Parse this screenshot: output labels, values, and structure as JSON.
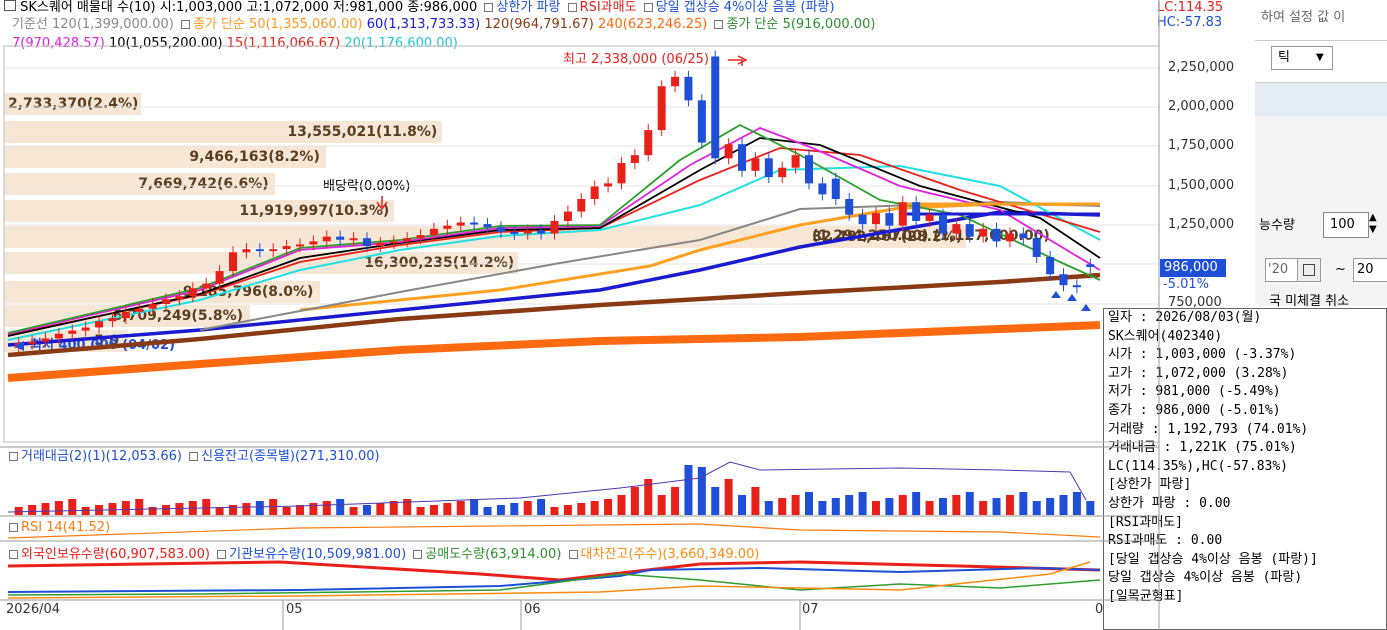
{
  "legend": {
    "line1_prefix": "SK스퀘어 매물대 수(10)",
    "line1_ohlc": "시:1,003,000 고:1,072,000 저:981,000 종:986,000",
    "line1_upper": "상한가 파랑",
    "line1_rsi": "RSI과매도",
    "line1_gap": "당일 갭상승 4%이상 음봉 (파랑)",
    "lc": "LC:114.35",
    "hc": "HC:-57.83",
    "line2_base": "기준선 120(1,399,000.00)",
    "line2_simple50": "종가 단순 50(1,355,060.00)",
    "line2_60": "60(1,313,733.33)",
    "line2_120": "120(964,791.67)",
    "line2_240": "240(623,246.25)",
    "line2_simple5": "종가 단순 5(916,000.00)",
    "line3_7": "7(970,428.57)",
    "line3_10": "10(1,055,200.00)",
    "line3_15": "15(1,116,066.67)",
    "line3_20": "20(1,176,600.00)"
  },
  "price_axis": {
    "ticks": [
      "2,250,000",
      "2,000,000",
      "1,750,000",
      "1,500,000",
      "1,250,000",
      "1,000,000",
      "750,000"
    ],
    "current_price": "986,000",
    "current_change": "-5.01%"
  },
  "annotations": {
    "high": "최고 2,338,000 (06/25)",
    "dividend": "배당락(0.00%)",
    "low": "최저 400,000 (04/02)"
  },
  "volume_profile": [
    {
      "label": "2,733,370(2.4%)"
    },
    {
      "label": "13,555,021(11.8%)"
    },
    {
      "label": "9,466,163(8.2%)"
    },
    {
      "label": "7,669,742(6.6%)"
    },
    {
      "label": "11,919,997(10.3%)"
    },
    {
      "label": "16,300,235(14.2%)"
    },
    {
      "label": "32,482,467(28.2%)"
    },
    {
      "label": "9,185,796(8.0%)"
    },
    {
      "label": "6,709,249(5.8%)"
    },
    {
      "label": "5,0"
    }
  ],
  "mid_overlay_text": "(1,294,250.00)  (1,127,000.00)",
  "sub_panels": {
    "volume_title": "거래대금(2)(1)(12,053.66)",
    "credit_title": "신용잔고(종목별)(271,310.00)",
    "rsi_title": "RSI 14(41.52)",
    "foreign": "외국인보유수량(60,907,583.00)",
    "institution": "기관보유수량(10,509,981.00)",
    "short": "공매도수량(63,914.00)",
    "lending": "대차잔고(주수)(3,660,349.00)"
  },
  "x_axis": [
    "2026/04",
    "05",
    "06",
    "07",
    "0"
  ],
  "right_panel": {
    "settings_text": "하여 설정 값 이",
    "tick_label": "틱",
    "qty_label": "능수량",
    "qty_value": "100",
    "date_from": "'20",
    "date_to": "20",
    "tilde": "~",
    "unfilled": "국 미체결 취소"
  },
  "tooltip": {
    "date": "일자     : 2026/08/03(월)",
    "name": "SK스퀘어(402340)",
    "open": " 시가     : 1,003,000 (-3.37%)",
    "high": " 고가     : 1,072,000 (3.28%)",
    "low": " 저가     : 981,000 (-5.49%)",
    "close": " 종가     : 986,000 (-5.01%)",
    "volume": " 거래량   : 1,192,793 (74.01%)",
    "amount": " 거래대금 : 1,221K (75.01%)",
    "lchc": " LC(114.35%),HC(-57.83%)",
    "s1_title": "[상한가 파랑]",
    "s1_val": " 상한가 파랑 : 0.00",
    "s2_title": "[RSI과매도]",
    "s2_val": " RSI과매도 : 0.00",
    "s3_title": "[당일 갭상승 4%이상 음봉 (파랑)]",
    "s3_val": " 당일 갭상승 4%이상 음봉 (파랑)",
    "s4_title": "[일목균형표]"
  },
  "colors": {
    "up": "#e8201a",
    "down": "#1e4fd6",
    "ma5": "#2e9e2e",
    "ma7": "#e020e0",
    "ma10": "#000000",
    "ma15": "#e8201a",
    "ma20": "#20e0e0",
    "ma60": "#1a1ad0",
    "ma50": "#ffa020",
    "ma120": "#8a3a12",
    "ma240": "#ff6a10",
    "base": "#888888"
  },
  "candles": [
    {
      "o": 470000,
      "c": 500000
    },
    {
      "o": 500000,
      "c": 510000
    },
    {
      "o": 510000,
      "c": 530000
    },
    {
      "o": 530000,
      "c": 560000
    },
    {
      "o": 560000,
      "c": 580000
    },
    {
      "o": 580000,
      "c": 600000
    },
    {
      "o": 600000,
      "c": 640000
    },
    {
      "o": 640000,
      "c": 660000
    },
    {
      "o": 660000,
      "c": 700000
    },
    {
      "o": 700000,
      "c": 720000
    },
    {
      "o": 720000,
      "c": 750000
    },
    {
      "o": 750000,
      "c": 780000
    },
    {
      "o": 780000,
      "c": 800000
    },
    {
      "o": 800000,
      "c": 850000
    },
    {
      "o": 850000,
      "c": 880000
    },
    {
      "o": 880000,
      "c": 960000
    },
    {
      "o": 960000,
      "c": 1080000
    },
    {
      "o": 1080000,
      "c": 1100000
    },
    {
      "o": 1100000,
      "c": 1090000
    },
    {
      "o": 1090000,
      "c": 1100000
    },
    {
      "o": 1100000,
      "c": 1120000
    },
    {
      "o": 1120000,
      "c": 1130000
    },
    {
      "o": 1130000,
      "c": 1150000
    },
    {
      "o": 1150000,
      "c": 1180000
    },
    {
      "o": 1180000,
      "c": 1160000
    },
    {
      "o": 1160000,
      "c": 1170000
    },
    {
      "o": 1170000,
      "c": 1120000
    },
    {
      "o": 1120000,
      "c": 1140000
    },
    {
      "o": 1140000,
      "c": 1150000
    },
    {
      "o": 1150000,
      "c": 1170000
    },
    {
      "o": 1170000,
      "c": 1190000
    },
    {
      "o": 1190000,
      "c": 1230000
    },
    {
      "o": 1230000,
      "c": 1250000
    },
    {
      "o": 1250000,
      "c": 1270000
    },
    {
      "o": 1270000,
      "c": 1260000
    },
    {
      "o": 1260000,
      "c": 1240000
    },
    {
      "o": 1240000,
      "c": 1210000
    },
    {
      "o": 1210000,
      "c": 1200000
    },
    {
      "o": 1200000,
      "c": 1220000
    },
    {
      "o": 1220000,
      "c": 1200000
    },
    {
      "o": 1200000,
      "c": 1280000
    },
    {
      "o": 1280000,
      "c": 1340000
    },
    {
      "o": 1340000,
      "c": 1420000
    },
    {
      "o": 1420000,
      "c": 1500000
    },
    {
      "o": 1500000,
      "c": 1520000
    },
    {
      "o": 1520000,
      "c": 1650000
    },
    {
      "o": 1650000,
      "c": 1700000
    },
    {
      "o": 1700000,
      "c": 1860000
    },
    {
      "o": 1860000,
      "c": 2140000
    },
    {
      "o": 2140000,
      "c": 2200000
    },
    {
      "o": 2200000,
      "c": 2050000
    },
    {
      "o": 2050000,
      "c": 1780000
    },
    {
      "o": 2330000,
      "c": 1680000
    },
    {
      "o": 1680000,
      "c": 1770000
    },
    {
      "o": 1770000,
      "c": 1600000
    },
    {
      "o": 1600000,
      "c": 1680000
    },
    {
      "o": 1680000,
      "c": 1560000
    },
    {
      "o": 1560000,
      "c": 1620000
    },
    {
      "o": 1620000,
      "c": 1700000
    },
    {
      "o": 1700000,
      "c": 1520000
    },
    {
      "o": 1520000,
      "c": 1450000
    },
    {
      "o": 1550000,
      "c": 1420000
    },
    {
      "o": 1420000,
      "c": 1320000
    },
    {
      "o": 1320000,
      "c": 1260000
    },
    {
      "o": 1260000,
      "c": 1330000
    },
    {
      "o": 1330000,
      "c": 1250000
    },
    {
      "o": 1250000,
      "c": 1400000
    },
    {
      "o": 1400000,
      "c": 1280000
    },
    {
      "o": 1280000,
      "c": 1320000
    },
    {
      "o": 1320000,
      "c": 1200000
    },
    {
      "o": 1200000,
      "c": 1260000
    },
    {
      "o": 1260000,
      "c": 1180000
    },
    {
      "o": 1180000,
      "c": 1230000
    },
    {
      "o": 1230000,
      "c": 1150000
    },
    {
      "o": 1150000,
      "c": 1200000
    },
    {
      "o": 1200000,
      "c": 1170000
    },
    {
      "o": 1170000,
      "c": 1050000
    },
    {
      "o": 1050000,
      "c": 940000
    },
    {
      "o": 940000,
      "c": 870000
    },
    {
      "o": 870000,
      "c": 860000
    },
    {
      "o": 1003000,
      "c": 986000
    }
  ]
}
